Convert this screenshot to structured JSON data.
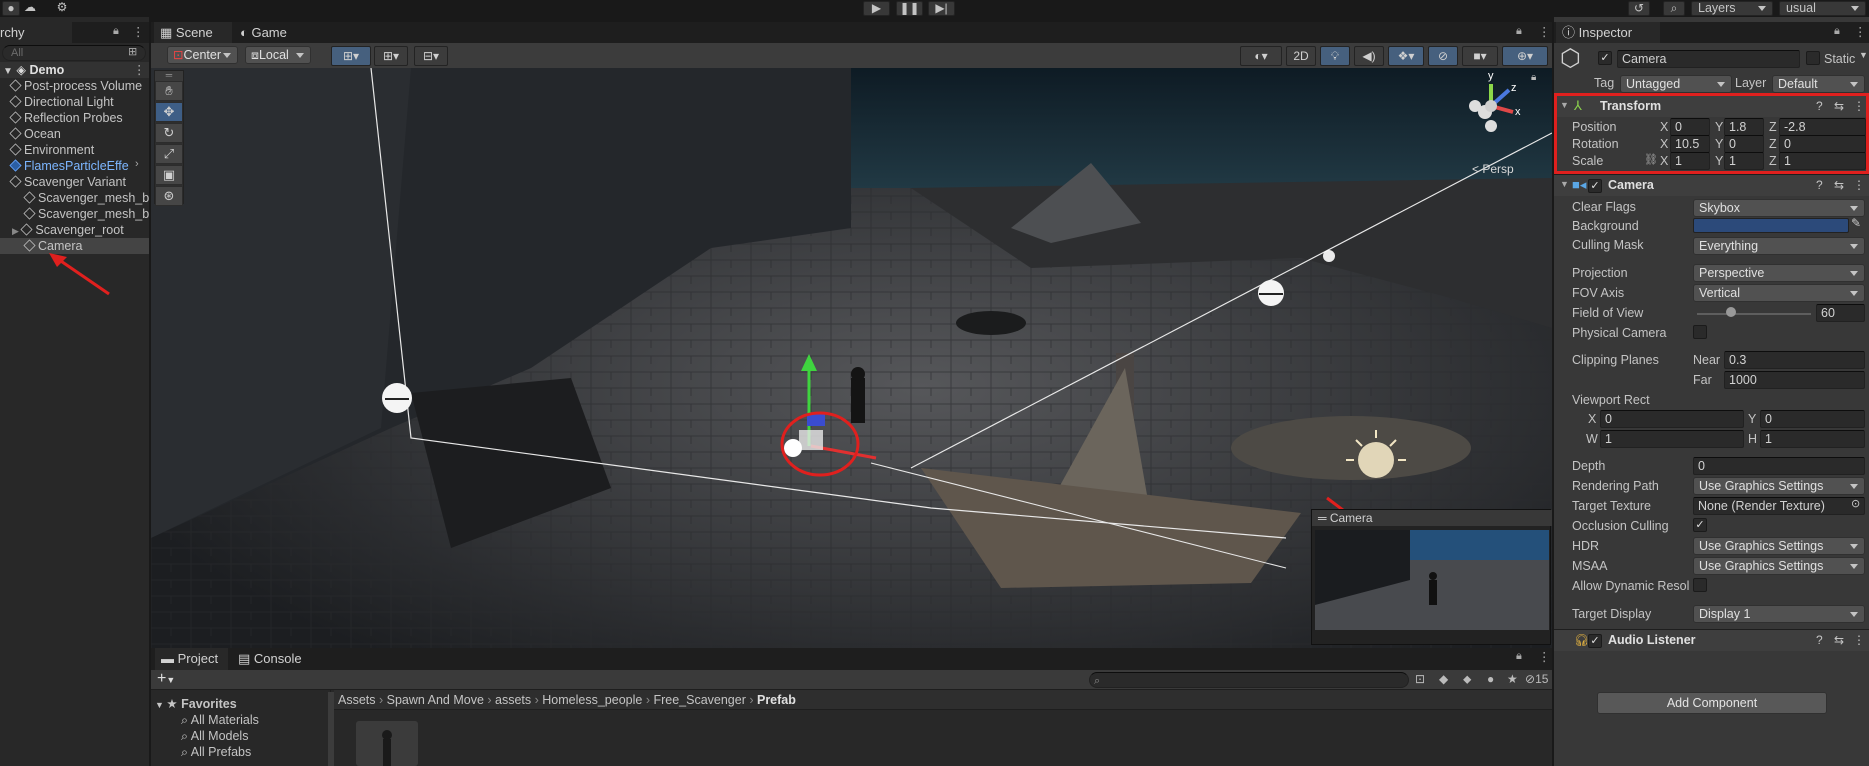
{
  "toolbar": {
    "layers_label": "Layers",
    "layout_label": "usual"
  },
  "hierarchy": {
    "tab_label": "rchy",
    "search_placeholder": "All",
    "scene_name": "Demo",
    "items": [
      {
        "label": "Post-process Volume"
      },
      {
        "label": "Directional Light"
      },
      {
        "label": "Reflection Probes"
      },
      {
        "label": "Ocean"
      },
      {
        "label": "Environment"
      },
      {
        "label": "FlamesParticleEffe"
      },
      {
        "label": "Scavenger Variant"
      },
      {
        "label": "Scavenger_mesh_b"
      },
      {
        "label": "Scavenger_mesh_b"
      },
      {
        "label": "Scavenger_root"
      },
      {
        "label": "Camera"
      }
    ]
  },
  "scene_tabs": {
    "scene": "Scene",
    "game": "Game"
  },
  "scene_toolbar": {
    "pivot": "Center",
    "space": "Local",
    "mode_2d": "2D",
    "persp_label": "< Persp",
    "gizmo_y": "y",
    "gizmo_x": "x",
    "gizmo_z": "z"
  },
  "camera_preview": {
    "title": "Camera"
  },
  "project": {
    "tab_project": "Project",
    "tab_console": "Console",
    "add_label": "+",
    "hidden_count": "15",
    "favorites_label": "Favorites",
    "favorites": [
      "All Materials",
      "All Models",
      "All Prefabs"
    ],
    "breadcrumb": [
      "Assets",
      "Spawn And Move",
      "assets",
      "Homeless_people",
      "Free_Scavenger",
      "Prefab"
    ]
  },
  "inspector": {
    "tab_label": "Inspector",
    "object_name": "Camera",
    "static_label": "Static",
    "tag_label": "Tag",
    "tag_value": "Untagged",
    "layer_label": "Layer",
    "layer_value": "Default",
    "transform": {
      "title": "Transform",
      "position_label": "Position",
      "rotation_label": "Rotation",
      "scale_label": "Scale",
      "position": {
        "x": "0",
        "y": "1.8",
        "z": "-2.8"
      },
      "rotation": {
        "x": "10.5",
        "y": "0",
        "z": "0"
      },
      "scale": {
        "x": "1",
        "y": "1",
        "z": "1"
      }
    },
    "camera": {
      "title": "Camera",
      "clear_flags_label": "Clear Flags",
      "clear_flags": "Skybox",
      "background_label": "Background",
      "background_color": "#2c4a7a",
      "culling_mask_label": "Culling Mask",
      "culling_mask": "Everything",
      "projection_label": "Projection",
      "projection": "Perspective",
      "fov_axis_label": "FOV Axis",
      "fov_axis": "Vertical",
      "fov_label": "Field of View",
      "fov": "60",
      "fov_slider_fraction": 0.3,
      "physical_label": "Physical Camera",
      "clipping_label": "Clipping Planes",
      "near_label": "Near",
      "near": "0.3",
      "far_label": "Far",
      "far": "1000",
      "viewport_label": "Viewport Rect",
      "vp_x": "0",
      "vp_y": "0",
      "vp_w": "1",
      "vp_h": "1",
      "depth_label": "Depth",
      "depth": "0",
      "rendering_path_label": "Rendering Path",
      "rendering_path": "Use Graphics Settings",
      "target_texture_label": "Target Texture",
      "target_texture": "None (Render Texture)",
      "occlusion_label": "Occlusion Culling",
      "hdr_label": "HDR",
      "hdr": "Use Graphics Settings",
      "msaa_label": "MSAA",
      "msaa": "Use Graphics Settings",
      "dynamic_res_label": "Allow Dynamic Resol",
      "target_display_label": "Target Display",
      "target_display": "Display 1"
    },
    "audio_listener": {
      "title": "Audio Listener"
    },
    "add_component": "Add Component"
  },
  "colors": {
    "highlight_red": "#e0201e",
    "selected_blue": "#2c5d87"
  }
}
